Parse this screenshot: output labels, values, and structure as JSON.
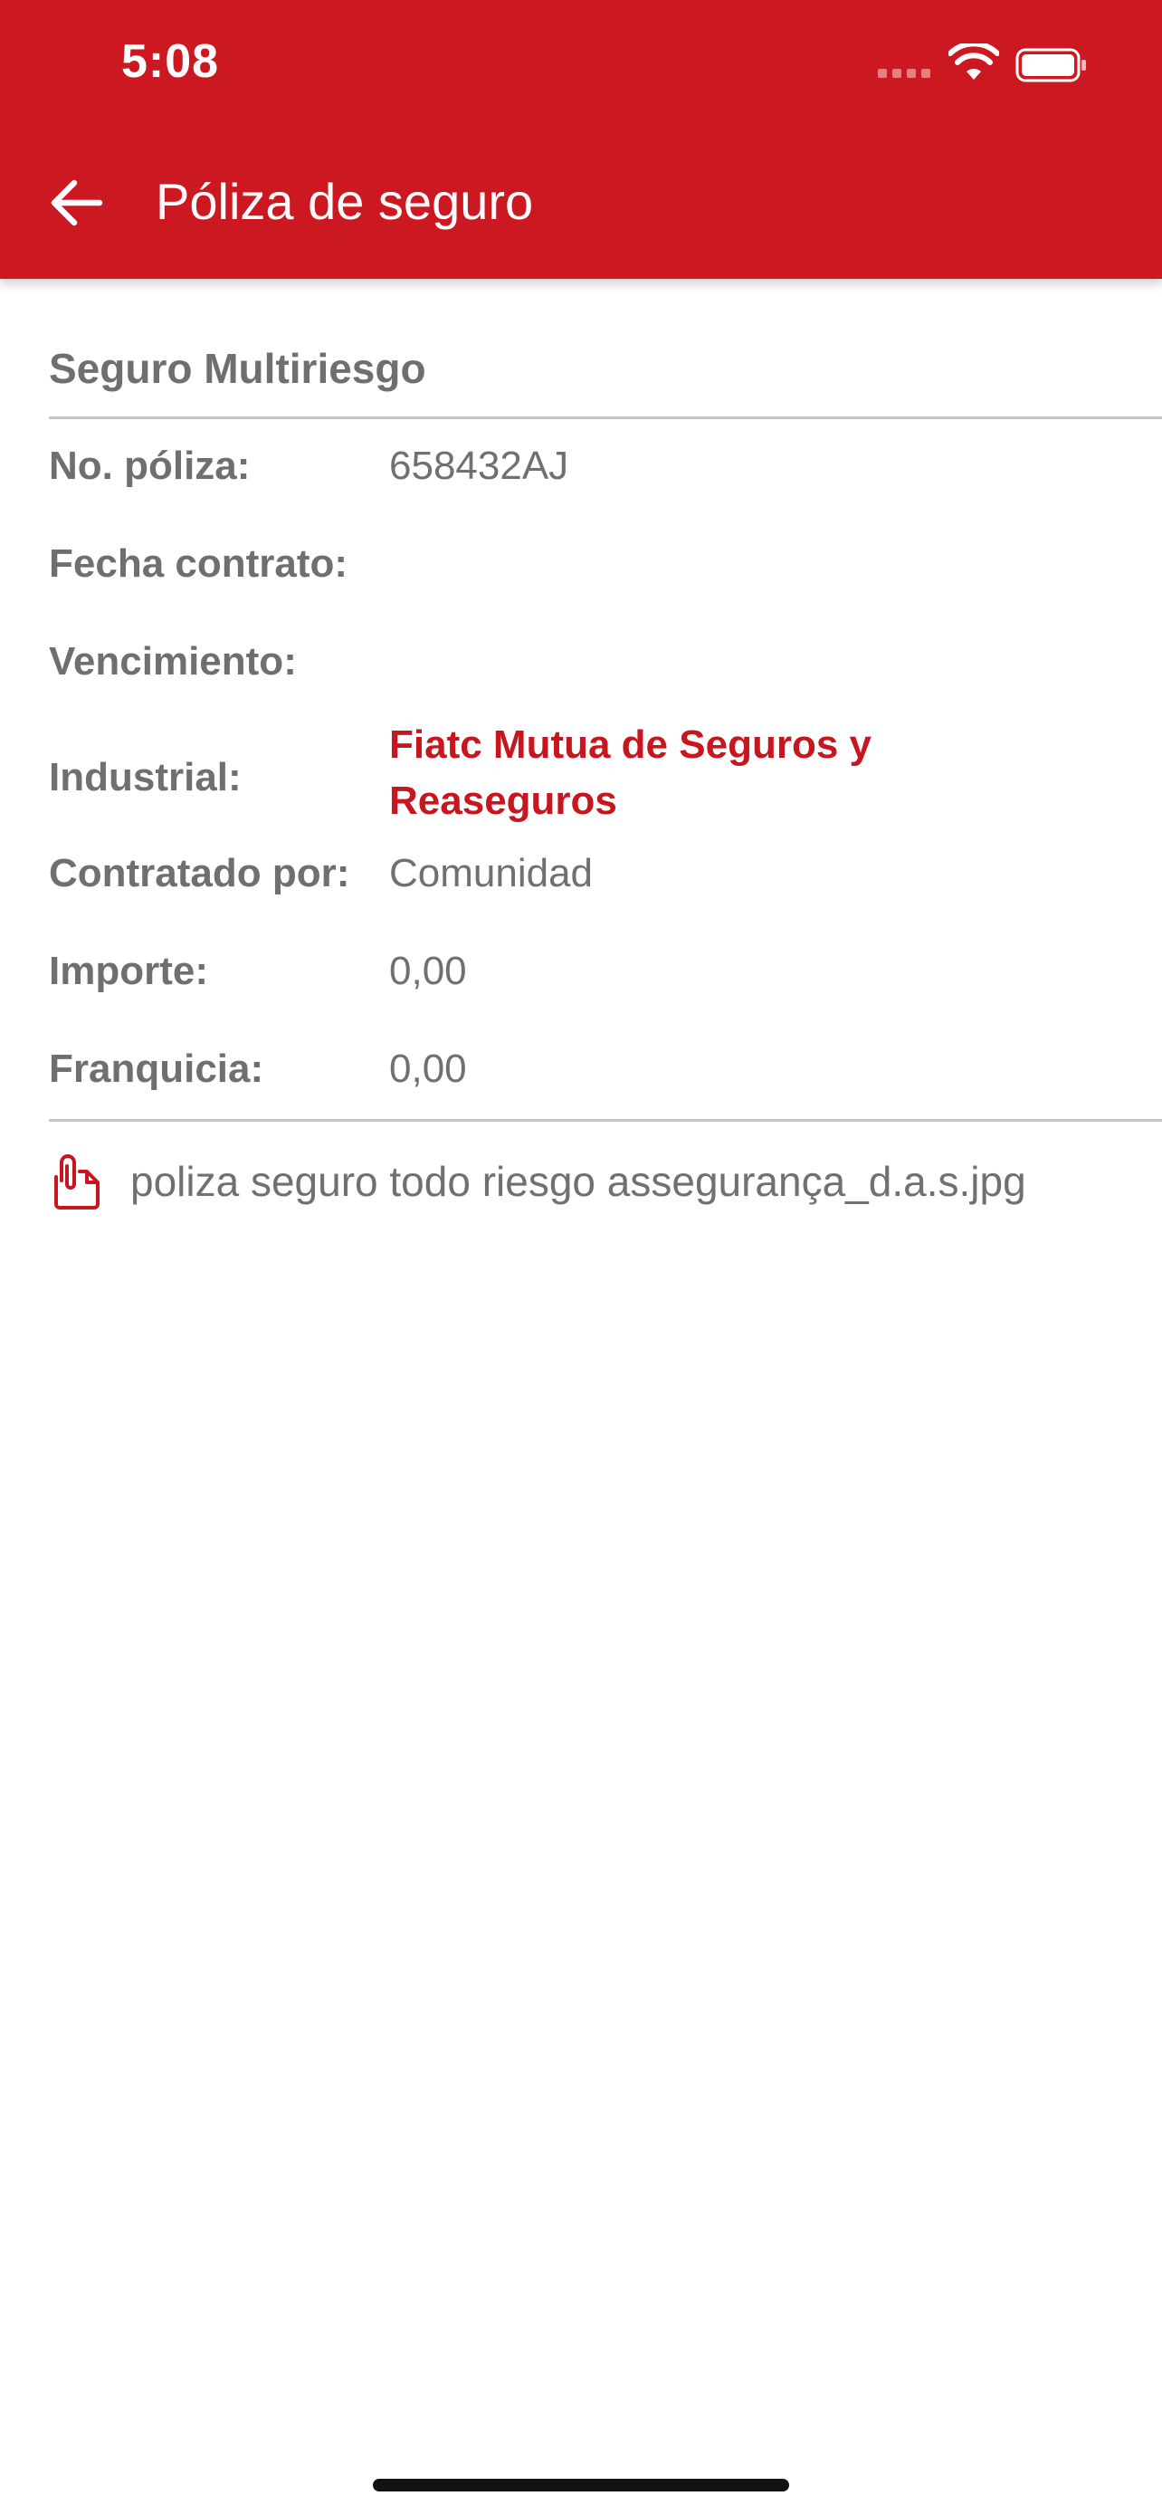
{
  "status_bar": {
    "time": "5:08",
    "icons": [
      "cellular-signal-icon",
      "wifi-icon",
      "battery-icon"
    ]
  },
  "app_bar": {
    "title": "Póliza de seguro",
    "back_icon": "arrow-left-icon"
  },
  "policy": {
    "section_title": "Seguro Multiriesgo",
    "fields": [
      {
        "label": "No. póliza:",
        "value": "658432AJ"
      },
      {
        "label": "Fecha contrato:",
        "value": ""
      },
      {
        "label": "Vencimiento:",
        "value": ""
      },
      {
        "label": "Industrial:",
        "value": "Fiatc Mutua de Seguros y Reaseguros"
      },
      {
        "label": "Contratado por:",
        "value": "Comunidad"
      },
      {
        "label": "Importe:",
        "value": "0,00"
      },
      {
        "label": "Franquicia:",
        "value": "0,00"
      }
    ]
  },
  "attachment": {
    "icon": "paperclip-document-icon",
    "file_name": "poliza seguro todo riesgo assegurança_d.a.s.jpg"
  },
  "colors": {
    "brand": "#CC1820",
    "label_text": "#6F6F6F",
    "link_text": "#C8161E"
  }
}
